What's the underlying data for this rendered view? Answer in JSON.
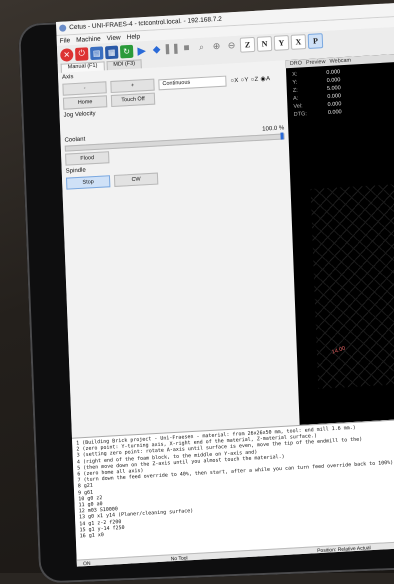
{
  "window": {
    "title": "Cetus - UNI-FRAES-4 - tctcontrol.local. - 192.168.7.2"
  },
  "menu": [
    "File",
    "Machine",
    "View",
    "Help"
  ],
  "view_buttons": [
    "Z",
    "N",
    "Y",
    "X",
    "P"
  ],
  "tabs": [
    "Manual (F1)",
    "MDI (F3)"
  ],
  "axis": {
    "label": "Axis",
    "minus": "-",
    "plus": "+",
    "mode": "Continuous",
    "radios": "○X ○Y ○Z ◉A",
    "home": "Home",
    "touch_off": "Touch Off"
  },
  "jog_velocity_label": "Jog Velocity",
  "coolant": {
    "label": "Coolant",
    "override": "100.0 %",
    "flood": "Flood"
  },
  "spindle": {
    "label": "Spindle",
    "stop": "Stop",
    "cw": "CW"
  },
  "right_tabs": [
    "DRO",
    "Preview",
    "Webcam"
  ],
  "dro": [
    {
      "axis": "X:",
      "value": "0.000"
    },
    {
      "axis": "Y:",
      "value": "0.000"
    },
    {
      "axis": "Z:",
      "value": "5.000"
    },
    {
      "axis": "A:",
      "value": "0.000"
    },
    {
      "axis": "Vel:",
      "value": "0.000"
    },
    {
      "axis": "DTG:",
      "value": "0.000"
    }
  ],
  "grid_label": "14.00",
  "log": [
    "1 (Building Brick project - Uni-Fraesen - material: from 26x26x50 mm, tool: end mill 1.6 mm.)",
    "2 (zero point: Y-turning axis, X-right end of the material, Z-material surface.)",
    "3 (setting zero point: rotate A-axis until surface is even, move the tip of the endmill to the)",
    "4 (right end of the foam block, to the middle on Y-axis and)",
    "5 (then move down on the Z-axis until you almost touch the material.)",
    "6 (zero home all axis)",
    "7 (turn down the feed override to 40%, then start, after a while you can turn feed override back to 100%)",
    "8 g21",
    "9 g61",
    "10 g0 z2",
    "11 g0 a0",
    "12 m03 S10000",
    "13 g0 x1 y14 (Planer/cleaning surface)",
    "14 g1 z-2 f200",
    "15 g1 y-14 f250",
    "16 g1 x0"
  ],
  "status": {
    "mode": "ON",
    "tool": "No Tool",
    "position": "Position: Relative Actual"
  }
}
